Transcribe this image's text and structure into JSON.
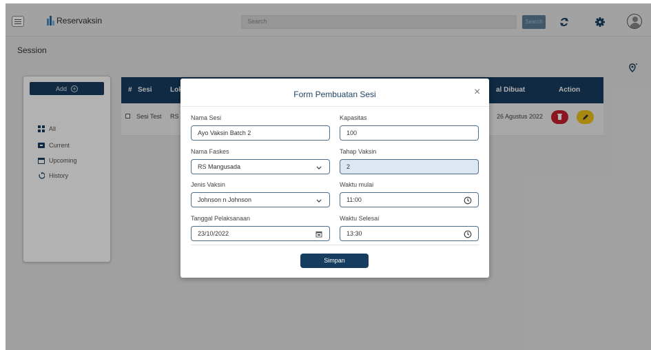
{
  "header": {
    "brand": "Reservaksin",
    "search_placeholder": "Search",
    "search_button": "Search"
  },
  "page": {
    "title": "Session"
  },
  "sidebar": {
    "add_label": "Add",
    "items": [
      {
        "label": "All",
        "icon": "grid-icon"
      },
      {
        "label": "Current",
        "icon": "screen-icon"
      },
      {
        "label": "Upcoming",
        "icon": "calendar-icon"
      },
      {
        "label": "History",
        "icon": "history-icon"
      }
    ]
  },
  "table": {
    "columns": [
      "#",
      "Sesi",
      "Lok",
      "al Dibuat",
      "Action"
    ],
    "rows": [
      {
        "sesi": "Sesi Test",
        "lokasi": "RS",
        "dibuat": "26 Agustus 2022"
      }
    ]
  },
  "modal": {
    "title": "Form Pembuatan Sesi",
    "close": "×",
    "fields": {
      "nama_sesi": {
        "label": "Nama Sesi",
        "value": "Ayo Vaksin Batch 2"
      },
      "kapasitas": {
        "label": "Kapasitas",
        "value": "100"
      },
      "nama_faskes": {
        "label": "Nama Faskes",
        "value": "RS Mangusada"
      },
      "tahap_vaksin": {
        "label": "Tahap Vaksin",
        "value": "2"
      },
      "jenis_vaksin": {
        "label": "Jenis Vaksin",
        "value": "Johnson n Johnson"
      },
      "waktu_mulai": {
        "label": "Waktu mulai",
        "value": "11:00"
      },
      "tanggal": {
        "label": "Tanggal Pelaksanaan",
        "value": "23/10/2022"
      },
      "waktu_selesai": {
        "label": "Waktu Selesai",
        "value": "13:30"
      }
    },
    "save_label": "Simpan"
  },
  "colors": {
    "primary": "#163d5f",
    "delete": "#c8202f",
    "edit": "#f0c419"
  }
}
